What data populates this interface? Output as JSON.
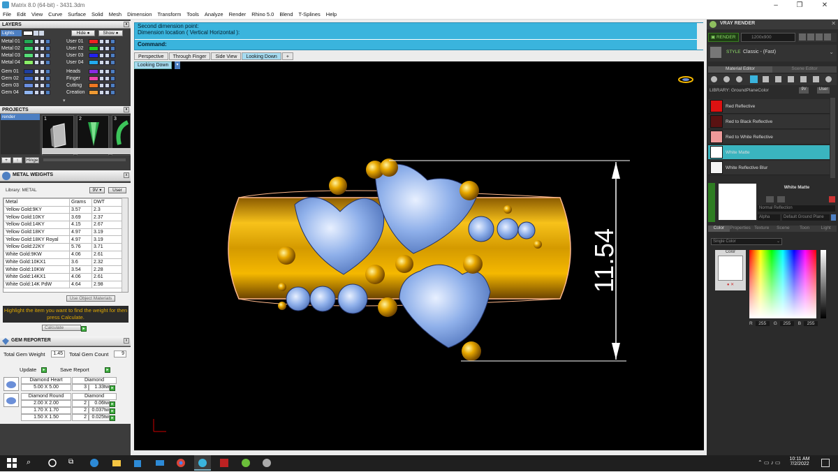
{
  "window": {
    "title": "Matrix 8.0 (64-bit) - 3431.3dm"
  },
  "menu": [
    "File",
    "Edit",
    "View",
    "Curve",
    "Surface",
    "Solid",
    "Mesh",
    "Dimension",
    "Transform",
    "Tools",
    "Analyze",
    "Render",
    "Rhino 5.0",
    "Blend",
    "T-Splines",
    "Help"
  ],
  "layers": {
    "title": "LAYERS",
    "lights": "Lights",
    "hide": "Hide",
    "show": "Show",
    "left": [
      {
        "name": "Metal 01",
        "color": "#22aa55"
      },
      {
        "name": "Metal 02",
        "color": "#33cc66"
      },
      {
        "name": "Metal 03",
        "color": "#55dd77"
      },
      {
        "name": "Metal 04",
        "color": "#88ee66"
      },
      {
        "name": "Gem 01",
        "color": "#1f3fa0"
      },
      {
        "name": "Gem 02",
        "color": "#3a64c8"
      },
      {
        "name": "Gem 03",
        "color": "#6a8fe0"
      },
      {
        "name": "Gem 04",
        "color": "#8fb4f0"
      }
    ],
    "right": [
      {
        "name": "User 01",
        "color": "#ee2222"
      },
      {
        "name": "User 02",
        "color": "#22cc22"
      },
      {
        "name": "User 03",
        "color": "#2222ee"
      },
      {
        "name": "User 04",
        "color": "#22aaee"
      },
      {
        "name": "Heads",
        "color": "#8a2be2"
      },
      {
        "name": "Finger",
        "color": "#ee44aa"
      },
      {
        "name": "Cutting",
        "color": "#ee7722"
      },
      {
        "name": "Creation",
        "color": "#ee9933"
      }
    ]
  },
  "projects": {
    "title": "PROJECTS",
    "item": "render",
    "thumbs": [
      "1",
      "2",
      "3"
    ],
    "hinge": "Hinge"
  },
  "metal": {
    "title": "METAL WEIGHTS",
    "library": "Library: METAL",
    "headers": [
      "Metal",
      "Grams",
      "DWT"
    ],
    "rows": [
      [
        "Yellow Gold:9KY",
        "3.57",
        "2.3"
      ],
      [
        "Yellow Gold:10KY",
        "3.69",
        "2.37"
      ],
      [
        "Yellow Gold:14KY",
        "4.15",
        "2.67"
      ],
      [
        "Yellow Gold:18KY",
        "4.97",
        "3.19"
      ],
      [
        "Yellow Gold:18KY Royal",
        "4.97",
        "3.19"
      ],
      [
        "Yellow Gold:22KY",
        "5.76",
        "3.71"
      ],
      [
        "White Gold:9KW",
        "4.06",
        "2.61"
      ],
      [
        "White Gold:10KX1",
        "3.6",
        "2.32"
      ],
      [
        "White Gold:10KW",
        "3.54",
        "2.28"
      ],
      [
        "White Gold:14KX1",
        "4.06",
        "2.61"
      ],
      [
        "White Gold:14K PdW",
        "4.64",
        "2.98"
      ]
    ],
    "use_obj": "Use Object Materials",
    "hint": "Highlight the item you want to find the weight for then press Calculate.",
    "calc": "Calculate"
  },
  "gem": {
    "title": "GEM REPORTER",
    "total_weight_label": "Total Gem Weight",
    "total_weight": "1.45",
    "total_count_label": "Total Gem Count",
    "total_count": "9",
    "update": "Update",
    "save": "Save Report",
    "heart": {
      "type": "Diamond Heart",
      "stone": "Diamond",
      "size": "5.00 X 5.00",
      "qty": "3",
      "ct": "1.33tw"
    },
    "round": {
      "type": "Diamond Round",
      "stone": "Diamond",
      "rows": [
        [
          "2.00 X 2.00",
          "2",
          "0.06tw"
        ],
        [
          "1.70 X 1.70",
          "2",
          "0.037tw"
        ],
        [
          "1.50 X 1.50",
          "2",
          "0.025tw"
        ]
      ]
    }
  },
  "command": {
    "line1": "Second dimension point:",
    "line2": "Dimension location ( Vertical  Horizontal ):",
    "prompt": "Command:"
  },
  "tabs": [
    "Perspective",
    "Through Finger",
    "Side View",
    "Looking Down"
  ],
  "viewport": {
    "name": "Looking Down",
    "dimension": "11.54"
  },
  "vray": {
    "title": "VRAY RENDER",
    "render": "RENDER",
    "resolution": "1200x900",
    "style": "STYLE",
    "style_value": "Classic - (Fast)",
    "editor_tab": "Material Editor",
    "scene_tab": "Scene Editor",
    "library": "LIBRARY: GroundPlaneColor",
    "materials": [
      {
        "name": "Red Reflective",
        "color": "#dd1111"
      },
      {
        "name": "Red to Black Reflective",
        "color": "#5a1212"
      },
      {
        "name": "Red to White Reflective",
        "color": "#ee9a9a"
      },
      {
        "name": "White Matte",
        "color": "#ffffff"
      },
      {
        "name": "White Reflective Blur",
        "color": "#f4f4f4"
      }
    ],
    "selected": "White Matte",
    "reflection": "Normal Reflection",
    "alpha": "Alpha",
    "ground": "Default Ground Plane",
    "subtabs": [
      "Color",
      "Properties",
      "Texture",
      "Scene",
      "Toon",
      "Light"
    ],
    "color_mode": "Single Color",
    "color_label": "Color",
    "rgb": [
      "255",
      "255",
      "255"
    ]
  },
  "clock": {
    "time": "10:11 AM",
    "date": "7/2/2022"
  }
}
